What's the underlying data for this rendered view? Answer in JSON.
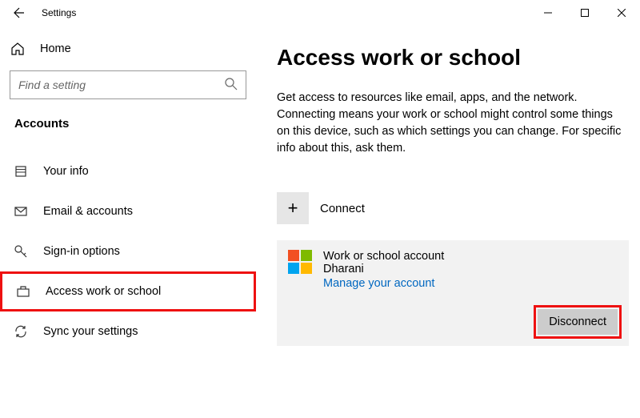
{
  "window": {
    "title": "Settings"
  },
  "sidebar": {
    "home_label": "Home",
    "search_placeholder": "Find a setting",
    "section": "Accounts",
    "items": [
      {
        "label": "Your info"
      },
      {
        "label": "Email & accounts"
      },
      {
        "label": "Sign-in options"
      },
      {
        "label": "Access work or school"
      },
      {
        "label": "Sync your settings"
      }
    ]
  },
  "main": {
    "title": "Access work or school",
    "description": "Get access to resources like email, apps, and the network. Connecting means your work or school might control some things on this device, such as which settings you can change. For specific info about this, ask them.",
    "connect_label": "Connect",
    "account": {
      "name": "Work or school account",
      "user": "Dharani",
      "manage_label": "Manage your account",
      "disconnect_label": "Disconnect"
    }
  }
}
